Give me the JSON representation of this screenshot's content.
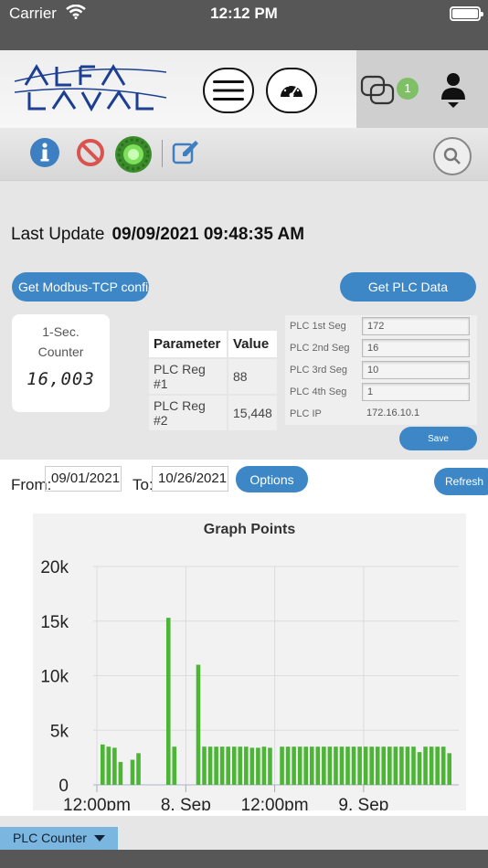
{
  "status_bar": {
    "carrier": "Carrier",
    "time": "12:12 PM"
  },
  "header": {
    "brand": "Alfa Laval",
    "notification_count": "1"
  },
  "last_update": {
    "label": "Last Update",
    "value": "09/09/2021 09:48:35 AM"
  },
  "buttons": {
    "modbus": "Get Modbus-TCP config",
    "plc_data": "Get PLC Data",
    "save": "Save",
    "options": "Options",
    "refresh": "Refresh"
  },
  "counter": {
    "label_line1": "1-Sec.",
    "label_line2": "Counter",
    "value": "16,003"
  },
  "params_table": {
    "headers": [
      "Parameter",
      "Value"
    ],
    "rows": [
      [
        "PLC Reg #1",
        "88"
      ],
      [
        "PLC Reg #2",
        "15,448"
      ]
    ]
  },
  "plc_config": {
    "rows": [
      {
        "label": "PLC 1st Seg",
        "value": "172"
      },
      {
        "label": "PLC 2nd Seg",
        "value": "16"
      },
      {
        "label": "PLC 3rd Seg",
        "value": "10"
      },
      {
        "label": "PLC 4th Seg",
        "value": "1"
      },
      {
        "label": "PLC IP",
        "value": "172.16.10.1"
      }
    ]
  },
  "filters": {
    "from_label": "From:",
    "from_value": "09/01/2021",
    "to_label": "To:",
    "to_value": "10/26/2021"
  },
  "legend_select": {
    "selected": "PLC Counter"
  },
  "colors": {
    "accent": "#3d87c6",
    "bar": "#4cb536",
    "status_bar": "#575757"
  },
  "chart_data": {
    "type": "bar",
    "title": "Graph Points",
    "xlabel": "",
    "ylabel": "",
    "ylim": [
      0,
      20000
    ],
    "yticks": [
      "0",
      "5k",
      "10k",
      "15k",
      "20k"
    ],
    "xticks": [
      "12:00pm",
      "8. Sep",
      "12:00pm",
      "9. Sep"
    ],
    "grid": true,
    "color": "#4cb536",
    "values": [
      3700,
      3500,
      3400,
      2100,
      0,
      2300,
      2900,
      0,
      0,
      0,
      0,
      15300,
      3500,
      0,
      0,
      0,
      11000,
      3500,
      3500,
      3500,
      3500,
      3500,
      3500,
      3500,
      3500,
      3400,
      3400,
      3500,
      3400,
      0,
      3500,
      3500,
      3500,
      3500,
      3500,
      3500,
      3500,
      3500,
      3500,
      3500,
      3500,
      3500,
      3500,
      3500,
      3500,
      3500,
      3500,
      3500,
      3500,
      3500,
      3500,
      3500,
      3500,
      3000,
      3500,
      3500,
      3500,
      3500,
      2900
    ]
  }
}
